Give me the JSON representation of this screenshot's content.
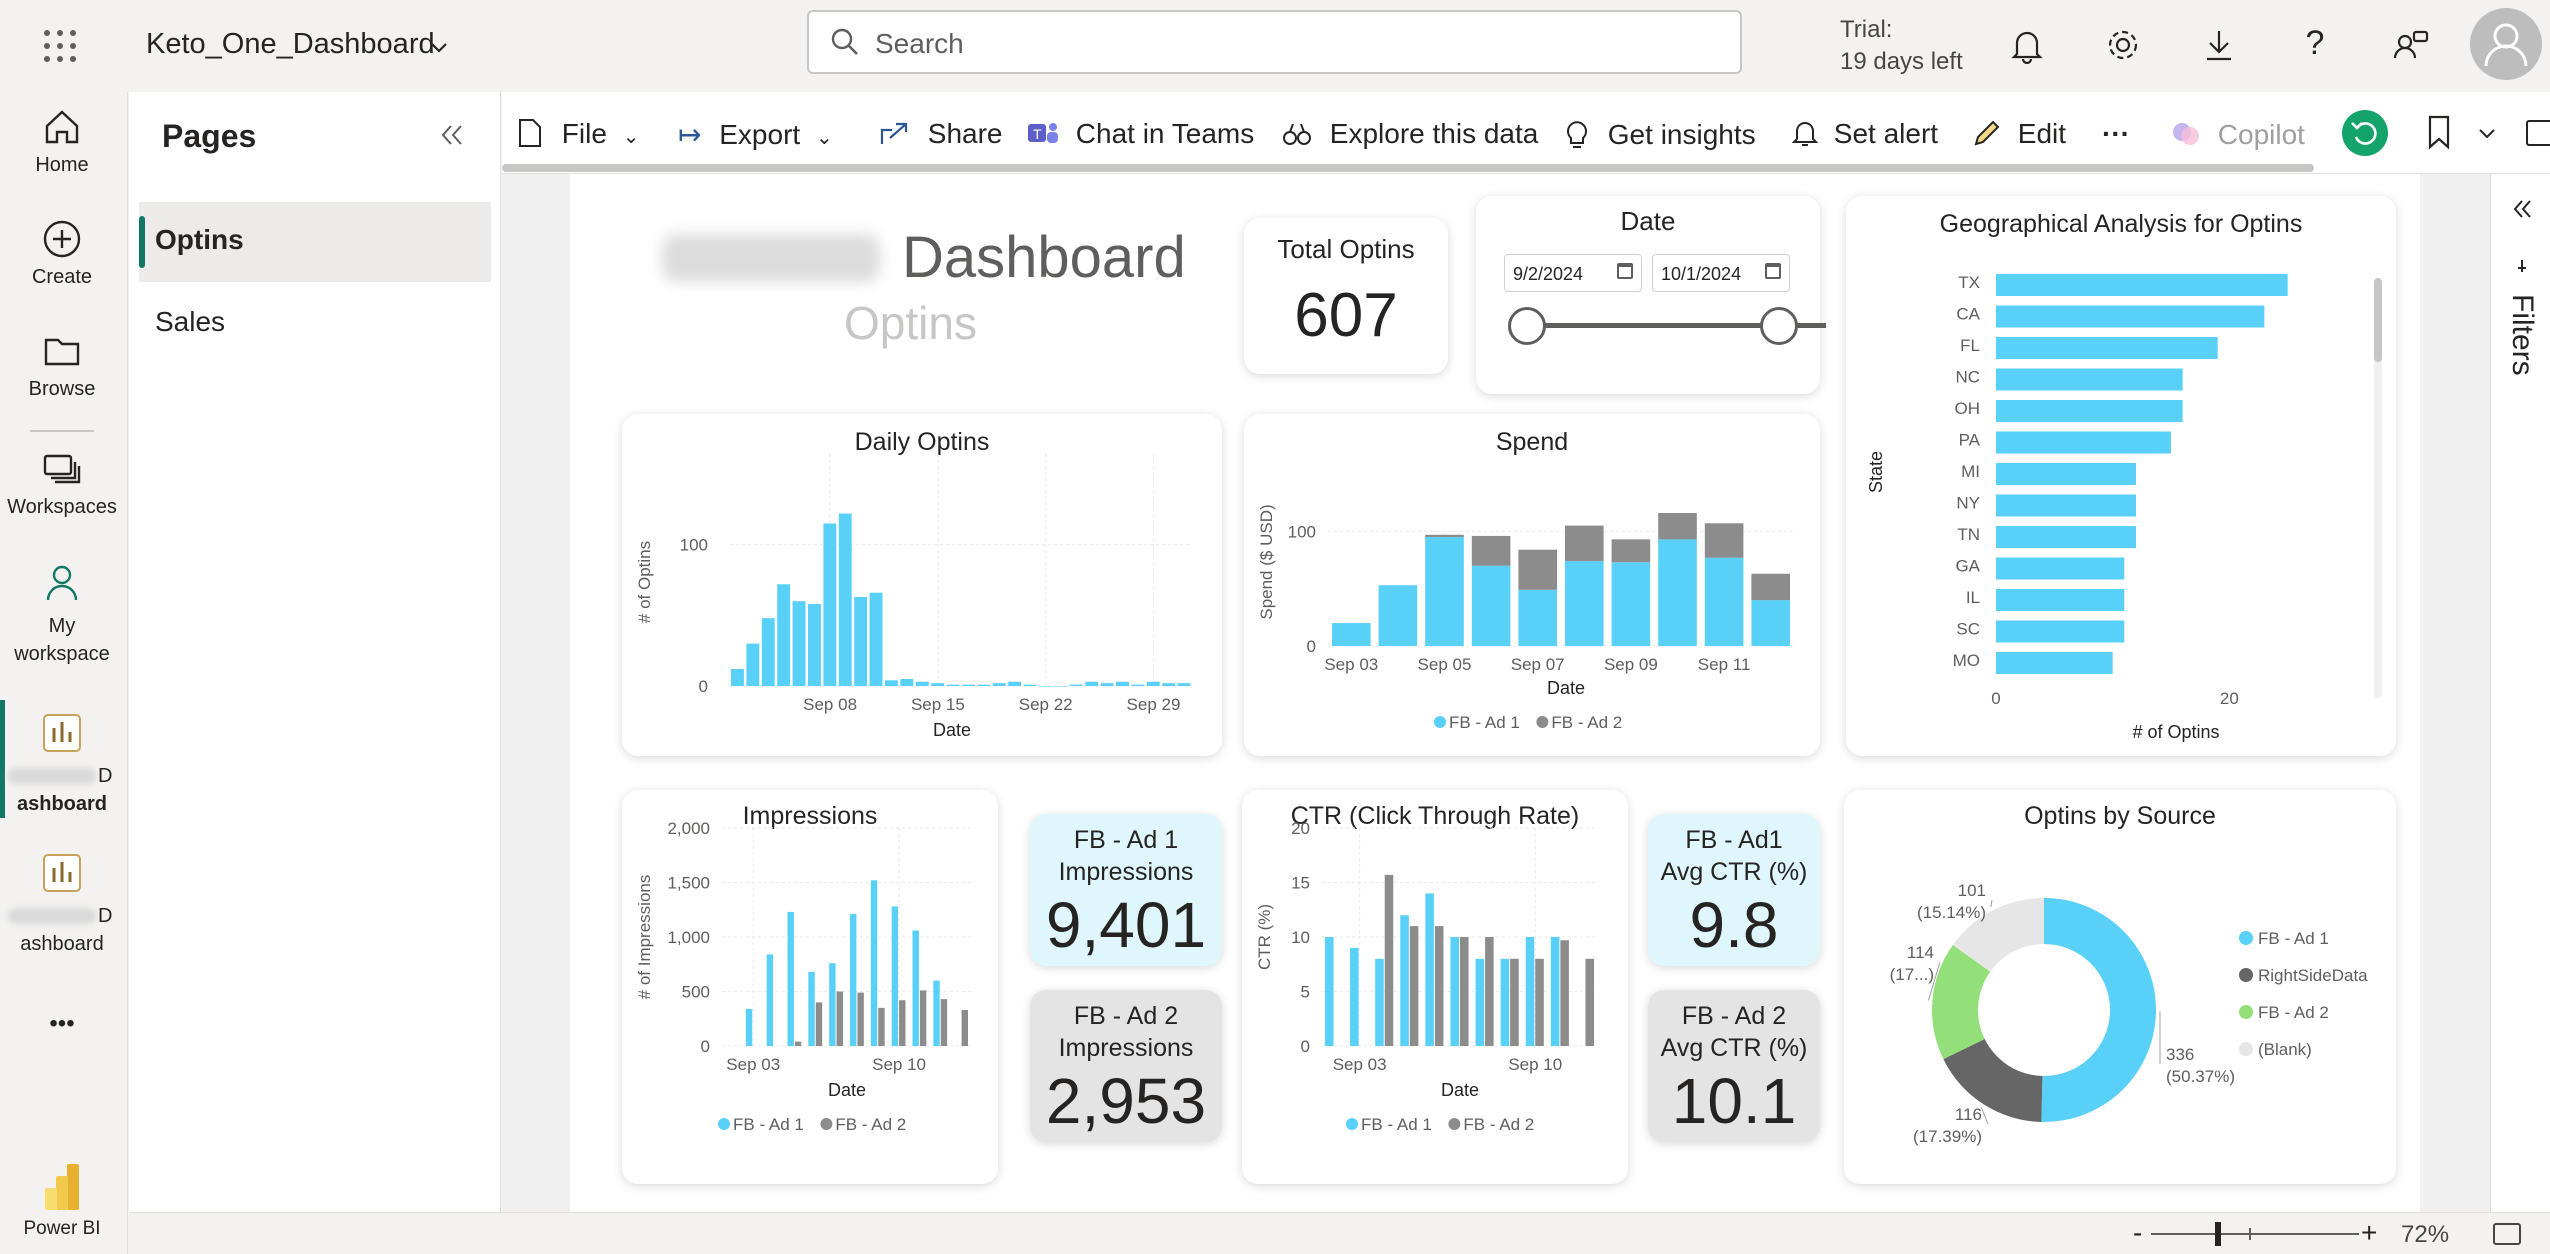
{
  "app": {
    "title": "Keto_One_Dashboard",
    "search_placeholder": "Search",
    "trial_line1": "Trial:",
    "trial_line2": "19 days left"
  },
  "rail": {
    "home": "Home",
    "create": "Create",
    "browse": "Browse",
    "workspaces": "Workspaces",
    "my_workspace_1": "My",
    "my_workspace_2": "workspace",
    "ws1_a": "D",
    "ws1_b": "ashboard",
    "ws2_a": "D",
    "ws2_b": "ashboard",
    "more": "•••",
    "powerbi": "Power BI"
  },
  "pages": {
    "title": "Pages",
    "items": [
      "Optins",
      "Sales"
    ]
  },
  "toolbar": {
    "file": "File",
    "export": "Export",
    "share": "Share",
    "chat": "Chat in Teams",
    "explore": "Explore this data",
    "insights": "Get insights",
    "alert": "Set alert",
    "edit": "Edit",
    "more": "···",
    "copilot": "Copilot"
  },
  "filters_label": "Filters",
  "zoom": "72%",
  "report": {
    "title": "Dashboard",
    "subtitle": "Optins",
    "total_optins_label": "Total Optins",
    "total_optins_value": "607",
    "date_label": "Date",
    "date_start": "9/2/2024",
    "date_end": "10/1/2024",
    "fb_ad1_impr_label_1": "FB - Ad 1",
    "fb_ad1_impr_label_2": "Impressions",
    "fb_ad1_impr_value": "9,401",
    "fb_ad2_impr_label_1": "FB - Ad 2",
    "fb_ad2_impr_label_2": "Impressions",
    "fb_ad2_impr_value": "2,953",
    "fb_ad1_ctr_label_1": "FB - Ad1",
    "fb_ad1_ctr_label_2": "Avg CTR (%)",
    "fb_ad1_ctr_value": "9.8",
    "fb_ad2_ctr_label_1": "FB - Ad 2",
    "fb_ad2_ctr_label_2": "Avg CTR (%)",
    "fb_ad2_ctr_value": "10.1"
  },
  "colors": {
    "ad1": "#59d0f8",
    "ad2": "#8c8c8c",
    "green": "#93e07a",
    "blank": "#e6e6e6",
    "accent": "#117865"
  },
  "chart_data": [
    {
      "type": "bar",
      "title": "Daily Optins",
      "xlabel": "Date",
      "ylabel": "# of Optins",
      "x_ticks": [
        "Sep 08",
        "Sep 15",
        "Sep 22",
        "Sep 29"
      ],
      "y_ticks": [
        0,
        100
      ],
      "ylim": [
        0,
        150
      ],
      "categories": [
        "Sep 02",
        "Sep 03",
        "Sep 04",
        "Sep 05",
        "Sep 06",
        "Sep 07",
        "Sep 08",
        "Sep 09",
        "Sep 10",
        "Sep 11",
        "Sep 12",
        "Sep 13",
        "Sep 14",
        "Sep 15",
        "Sep 16",
        "Sep 17",
        "Sep 18",
        "Sep 19",
        "Sep 20",
        "Sep 21",
        "Sep 22",
        "Sep 23",
        "Sep 24",
        "Sep 25",
        "Sep 26",
        "Sep 27",
        "Sep 28",
        "Sep 29",
        "Sep 30",
        "Oct 01"
      ],
      "values": [
        12,
        30,
        48,
        72,
        60,
        58,
        115,
        122,
        63,
        66,
        4,
        5,
        3,
        2,
        1,
        1,
        1,
        2,
        3,
        1,
        0,
        0,
        1,
        3,
        2,
        3,
        1,
        3,
        2,
        2
      ]
    },
    {
      "type": "bar",
      "title": "Spend",
      "xlabel": "Date",
      "ylabel": "Spend ($ USD)",
      "x_ticks": [
        "Sep 03",
        "Sep 05",
        "Sep 07",
        "Sep 09",
        "Sep 11"
      ],
      "y_ticks": [
        0,
        100
      ],
      "ylim": [
        0,
        150
      ],
      "stacked": true,
      "categories": [
        "Sep 03",
        "Sep 04",
        "Sep 05",
        "Sep 06",
        "Sep 07",
        "Sep 08",
        "Sep 09",
        "Sep 10",
        "Sep 11",
        "Sep 12"
      ],
      "series": [
        {
          "name": "FB - Ad 1",
          "values": [
            20,
            53,
            95,
            70,
            49,
            74,
            73,
            93,
            77,
            40
          ]
        },
        {
          "name": "FB - Ad 2",
          "values": [
            0,
            0,
            2,
            26,
            35,
            31,
            20,
            23,
            30,
            23
          ]
        }
      ]
    },
    {
      "type": "bar",
      "title": "Geographical Analysis for Optins",
      "xlabel": "# of Optins",
      "ylabel": "State",
      "x_ticks": [
        0,
        20
      ],
      "xlim": [
        0,
        30
      ],
      "orientation": "horizontal",
      "categories": [
        "TX",
        "CA",
        "FL",
        "NC",
        "OH",
        "PA",
        "MI",
        "NY",
        "TN",
        "GA",
        "IL",
        "SC",
        "MO"
      ],
      "values": [
        25,
        23,
        19,
        16,
        16,
        15,
        12,
        12,
        12,
        11,
        11,
        11,
        10
      ]
    },
    {
      "type": "bar",
      "title": "Impressions",
      "xlabel": "Date",
      "ylabel": "# of Impressions",
      "x_ticks": [
        "Sep 03",
        "Sep 10"
      ],
      "y_ticks": [
        "0",
        "500",
        "1,000",
        "1,500",
        "2,000"
      ],
      "ylim": [
        0,
        2000
      ],
      "categories": [
        "Sep 02",
        "Sep 03",
        "Sep 04",
        "Sep 05",
        "Sep 06",
        "Sep 07",
        "Sep 08",
        "Sep 09",
        "Sep 10",
        "Sep 11",
        "Sep 12",
        "Sep 13"
      ],
      "series": [
        {
          "name": "FB - Ad 1",
          "values": [
            0,
            340,
            840,
            1230,
            680,
            760,
            1210,
            1520,
            1280,
            1060,
            600,
            0
          ]
        },
        {
          "name": "FB - Ad 2",
          "values": [
            0,
            0,
            0,
            40,
            400,
            500,
            490,
            350,
            420,
            510,
            430,
            330
          ]
        }
      ]
    },
    {
      "type": "bar",
      "title": "CTR (Click Through Rate)",
      "xlabel": "Date",
      "ylabel": "CTR (%)",
      "x_ticks": [
        "Sep 03",
        "Sep 10"
      ],
      "y_ticks": [
        0,
        5,
        10,
        15,
        20
      ],
      "ylim": [
        0,
        20
      ],
      "categories": [
        "Sep 02",
        "Sep 03",
        "Sep 04",
        "Sep 05",
        "Sep 06",
        "Sep 07",
        "Sep 08",
        "Sep 09",
        "Sep 10",
        "Sep 11",
        "Sep 12"
      ],
      "series": [
        {
          "name": "FB - Ad 1",
          "values": [
            10,
            9,
            8,
            12,
            14,
            10,
            8,
            8,
            10,
            10,
            0
          ]
        },
        {
          "name": "FB - Ad 2",
          "values": [
            0,
            0,
            15.7,
            11,
            11,
            10,
            10,
            8,
            8,
            9.7,
            8
          ]
        }
      ]
    },
    {
      "type": "pie",
      "donut": true,
      "title": "Optins by Source",
      "labels": [
        "FB - Ad 1",
        "RightSideData",
        "FB - Ad 2",
        "(Blank)"
      ],
      "values": [
        336,
        116,
        114,
        101
      ],
      "data_labels": [
        [
          "336",
          "(50.37%)"
        ],
        [
          "116",
          "(17.39%)"
        ],
        [
          "114",
          "(17...)"
        ],
        [
          "101",
          "(15.14%)"
        ]
      ]
    }
  ]
}
